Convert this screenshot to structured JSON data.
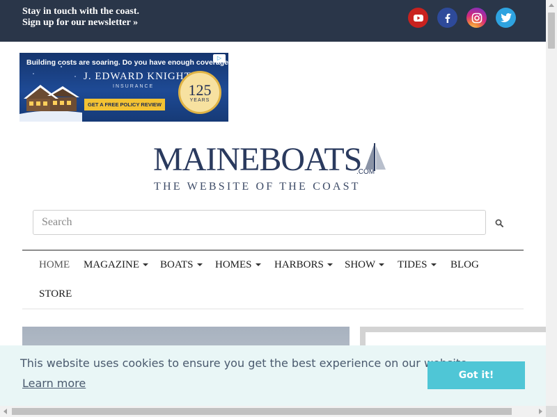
{
  "topbar": {
    "line1": "Stay in touch with the coast.",
    "line2": "Sign up for our newsletter »",
    "social": [
      {
        "name": "youtube",
        "color": "#c9221f"
      },
      {
        "name": "facebook",
        "color": "#2e4a9a"
      },
      {
        "name": "instagram",
        "color": "#d6297a"
      },
      {
        "name": "twitter",
        "color": "#2ea3e0"
      }
    ]
  },
  "ad": {
    "headline": "Building costs are soaring.  Do you have enough coverage?",
    "company": "J. EDWARD KNIGHT",
    "company_sub": "INSURANCE",
    "cta": "GET A FREE POLICY REVIEW",
    "badge_number": "125",
    "badge_label": "YEARS"
  },
  "logo": {
    "wordmark": "MAINEBOATS",
    "suffix": ".COM",
    "tagline": "THE WEBSITE OF THE COAST"
  },
  "search": {
    "placeholder": "Search",
    "value": ""
  },
  "nav": {
    "items": [
      {
        "label": "HOME",
        "dropdown": false
      },
      {
        "label": "MAGAZINE",
        "dropdown": true
      },
      {
        "label": "BOATS",
        "dropdown": true
      },
      {
        "label": "HOMES",
        "dropdown": true
      },
      {
        "label": "HARBORS",
        "dropdown": true
      },
      {
        "label": "SHOW",
        "dropdown": true
      },
      {
        "label": "TIDES",
        "dropdown": true
      },
      {
        "label": "BLOG",
        "dropdown": false
      },
      {
        "label": "STORE",
        "dropdown": false
      }
    ]
  },
  "cookie": {
    "message": "This website uses cookies to ensure you get the best experience on our website.",
    "learn_more": "Learn more",
    "button": "Got it!"
  },
  "colors": {
    "topbar_bg": "#2a3649",
    "brand_navy": "#2a3a5e",
    "cookie_bg": "#e9f6f6",
    "cookie_button": "#4fc6d6"
  }
}
